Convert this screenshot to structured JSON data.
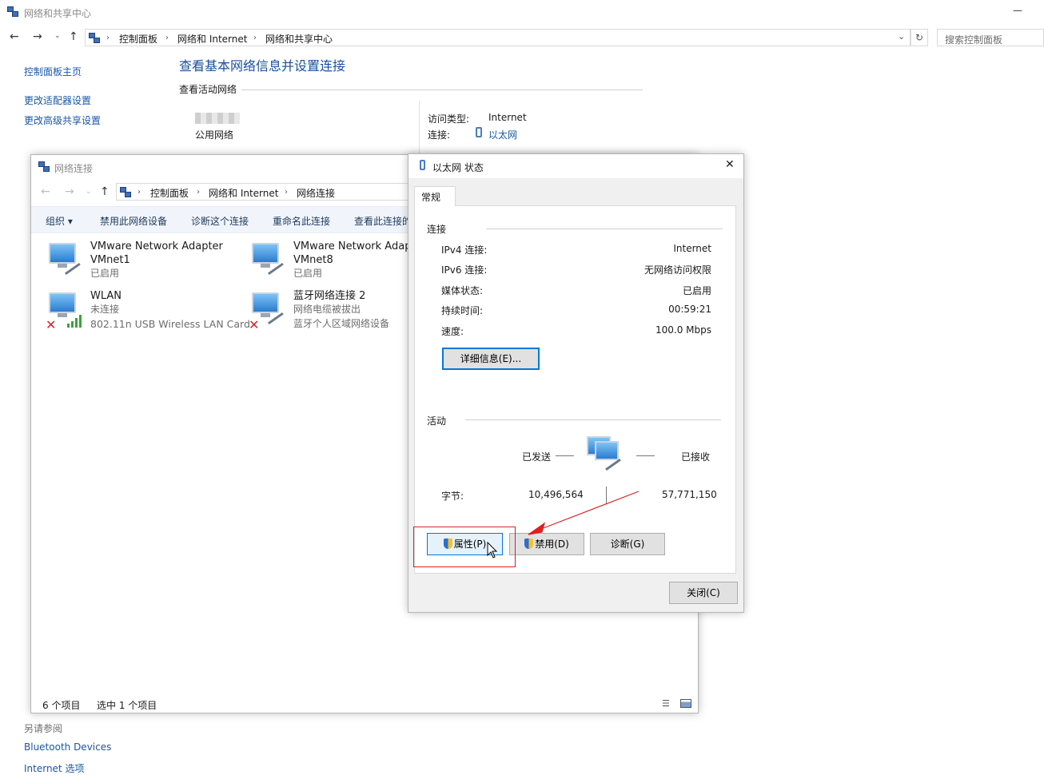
{
  "bg_window": {
    "title": "网络和共享中心",
    "minimize": "—",
    "breadcrumb": [
      "控制面板",
      "网络和 Internet",
      "网络和共享中心"
    ],
    "refresh": "↻",
    "search_placeholder": "搜索控制面板",
    "sidebar": {
      "home": "控制面板主页",
      "adapter_settings": "更改适配器设置",
      "advanced_sharing": "更改高级共享设置",
      "see_also": "另请参阅",
      "bluetooth": "Bluetooth Devices",
      "internet_options": "Internet 选项"
    },
    "heading": "查看基本网络信息并设置连接",
    "active_networks": "查看活动网络",
    "network_type": "公用网络",
    "access_type_label": "访问类型:",
    "access_type_value": "Internet",
    "connection_label": "连接:",
    "connection_value": "以太网"
  },
  "net_conn": {
    "title": "网络连接",
    "breadcrumb": [
      "控制面板",
      "网络和 Internet",
      "网络连接"
    ],
    "toolbar": [
      "组织 ▾",
      "禁用此网络设备",
      "诊断这个连接",
      "重命名此连接",
      "查看此连接的"
    ],
    "adapters": [
      {
        "name1": "VMware Network Adapter",
        "name2": "VMnet1",
        "status": "已启用",
        "device": ""
      },
      {
        "name1": "VMware Network Adapter",
        "name2": "VMnet8",
        "status": "已启用",
        "device": ""
      },
      {
        "name1": "WLAN",
        "name2": "",
        "status": "未连接",
        "device": "802.11n USB Wireless LAN Card"
      },
      {
        "name1": "蓝牙网络连接 2",
        "name2": "",
        "status": "网络电缆被拔出",
        "device": "蓝牙个人区域网络设备"
      }
    ],
    "status_count": "6 个项目",
    "status_selected": "选中 1 个项目"
  },
  "status_dialog": {
    "title": "以太网 状态",
    "close": "✕",
    "tab": "常规",
    "connection_section": "连接",
    "rows": [
      {
        "label": "IPv4 连接:",
        "value": "Internet"
      },
      {
        "label": "IPv6 连接:",
        "value": "无网络访问权限"
      },
      {
        "label": "媒体状态:",
        "value": "已启用"
      },
      {
        "label": "持续时间:",
        "value": "00:59:21"
      },
      {
        "label": "速度:",
        "value": "100.0 Mbps"
      }
    ],
    "details_button": "详细信息(E)...",
    "activity_section": "活动",
    "sent_label": "已发送",
    "received_label": "已接收",
    "bytes_label": "字节:",
    "bytes_sent": "10,496,564",
    "bytes_received": "57,771,150",
    "properties_button": "属性(P)",
    "disable_button": "禁用(D)",
    "diagnose_button": "诊断(G)",
    "close_button": "关闭(C)"
  },
  "colors": {
    "link": "#1a56a8",
    "annotation_red": "#e02020",
    "focus_blue": "#0078d7"
  }
}
